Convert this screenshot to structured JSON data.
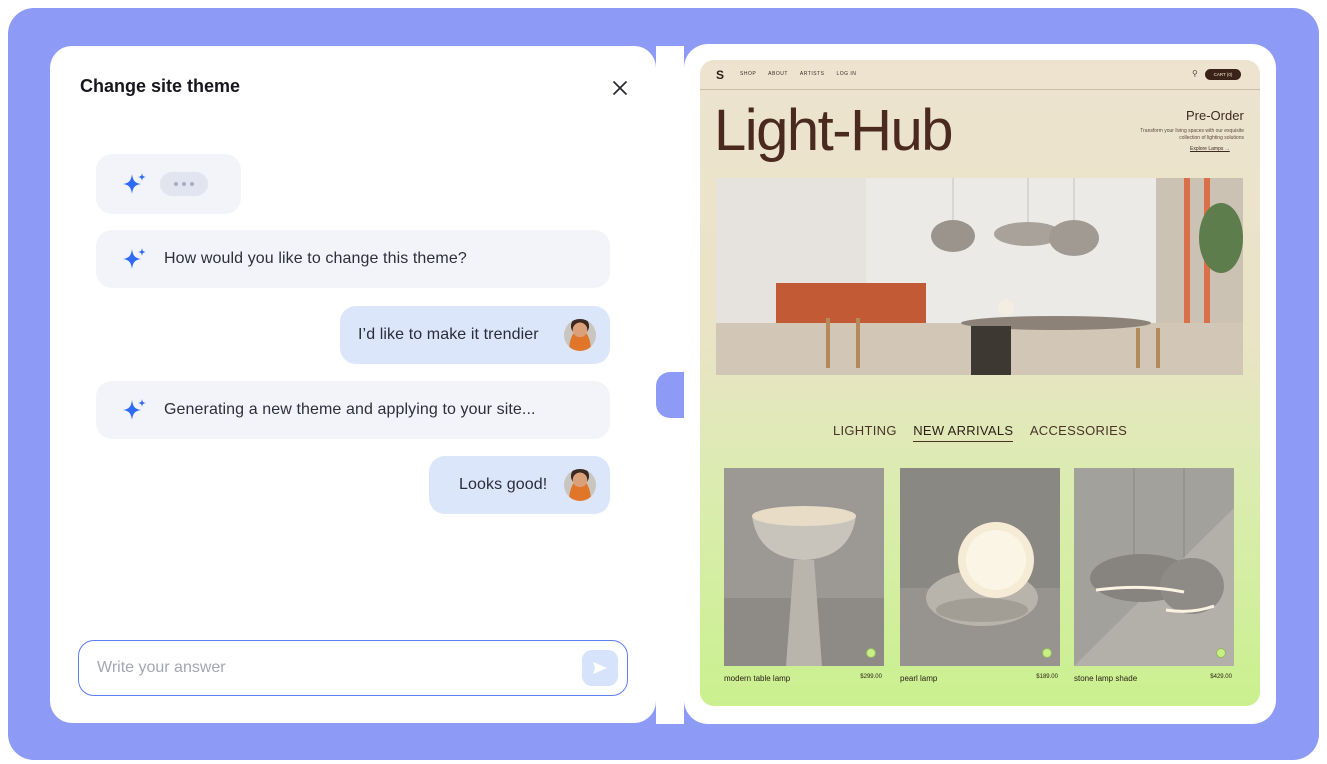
{
  "chat": {
    "title": "Change site theme",
    "messages": [
      {
        "role": "bot",
        "text": "How would you like to change this theme?"
      },
      {
        "role": "user",
        "text": "I’d like to make it trendier"
      },
      {
        "role": "bot",
        "text": "Generating a new theme and applying to your site..."
      },
      {
        "role": "user",
        "text": "Looks good!"
      }
    ],
    "input_placeholder": "Write your answer"
  },
  "site": {
    "nav": [
      "SHOP",
      "ABOUT",
      "ARTISTS",
      "LOG IN"
    ],
    "cart_label": "CART (0)",
    "title": "Light-Hub",
    "preorder": {
      "heading": "Pre-Order",
      "text": "Transform your living spaces with our exquisite collection of lighting solutions",
      "link": "Explore Lamps →"
    },
    "tabs": [
      "LIGHTING",
      "NEW ARRIVALS",
      "ACCESSORIES"
    ],
    "active_tab": "NEW ARRIVALS",
    "products": [
      {
        "name": "modern table lamp",
        "price": "$299.00"
      },
      {
        "name": "pearl lamp",
        "price": "$189.00"
      },
      {
        "name": "stone lamp shade",
        "price": "$429.00"
      }
    ]
  },
  "colors": {
    "frame": "#8d9bf6",
    "accent": "#5c7ef0",
    "user_bubble": "#dbe6fb",
    "bot_bubble": "#f3f4f9",
    "site_title": "#4a2a1e"
  },
  "icons": [
    "sparkle-icon",
    "close-icon",
    "send-icon",
    "search-icon",
    "plus-icon"
  ]
}
